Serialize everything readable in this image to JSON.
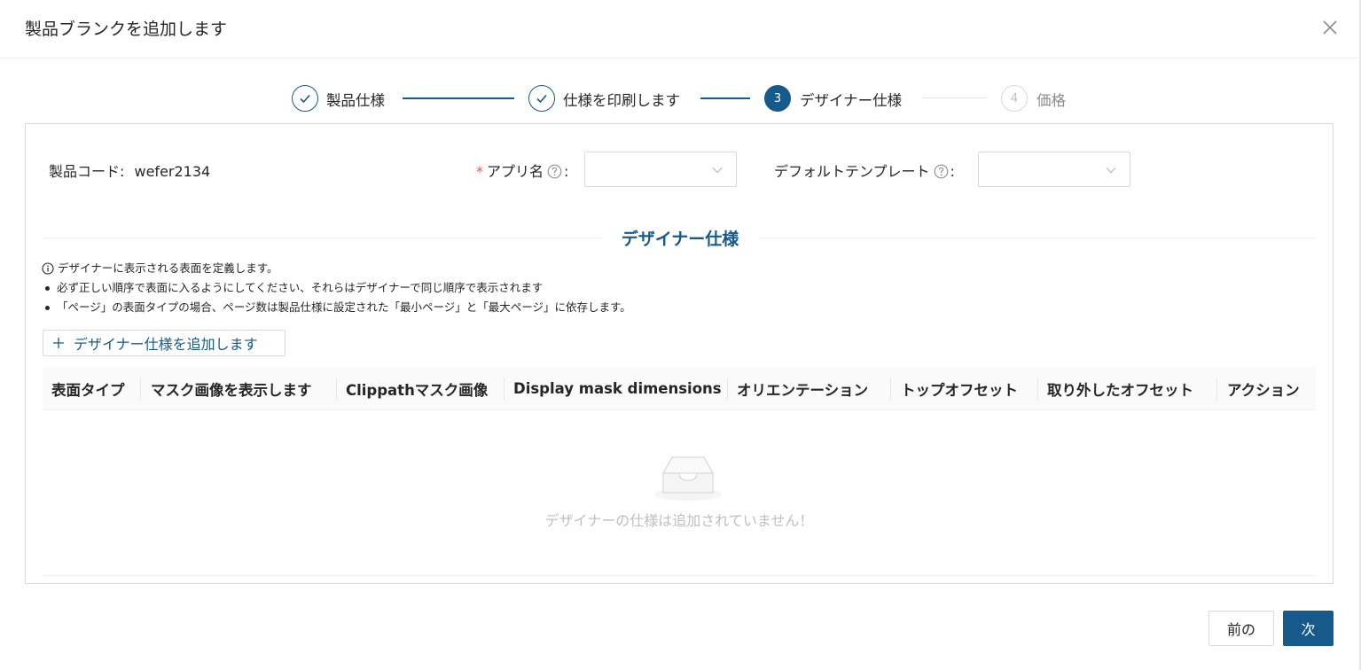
{
  "dialog": {
    "title": "製品ブランクを追加します"
  },
  "steps": [
    {
      "label": "製品仕様",
      "status": "done",
      "number": "1"
    },
    {
      "label": "仕様を印刷します",
      "status": "done",
      "number": "2"
    },
    {
      "label": "デザイナー仕様",
      "status": "active",
      "number": "3"
    },
    {
      "label": "価格",
      "status": "wait",
      "number": "4"
    }
  ],
  "form": {
    "product_code_label": "製品コード:",
    "product_code_value": "wefer2134",
    "app_name_label": "アプリ名",
    "app_name_colon": ":",
    "app_name_value": "",
    "template_label": "デフォルトテンプレート",
    "template_colon": ":",
    "template_value": ""
  },
  "section": {
    "title": "デザイナー仕様",
    "info": "デザイナーに表示される表面を定義します。",
    "bullets": [
      "必ず正しい順序で表面に入るようにしてください、それらはデザイナーで同じ順序で表示されます",
      "「ページ」の表面タイプの場合、ページ数は製品仕様に設定された「最小ページ」と「最大ページ」に依存します。"
    ],
    "add_button": "デザイナー仕様を追加します"
  },
  "table": {
    "columns": [
      "表面タイプ",
      "マスク画像を表示します",
      "Clippathマスク画像",
      "Display mask dimensions",
      "オリエンテーション",
      "トップオフセット",
      "取り外したオフセット",
      "アクション"
    ],
    "rows": [],
    "empty_text": "デザイナーの仕様は追加されていません！"
  },
  "footer": {
    "prev_label": "前の",
    "next_label": "次"
  },
  "colors": {
    "primary": "#155a8a",
    "required": "#ff4d4f",
    "border": "#d9d9d9"
  }
}
